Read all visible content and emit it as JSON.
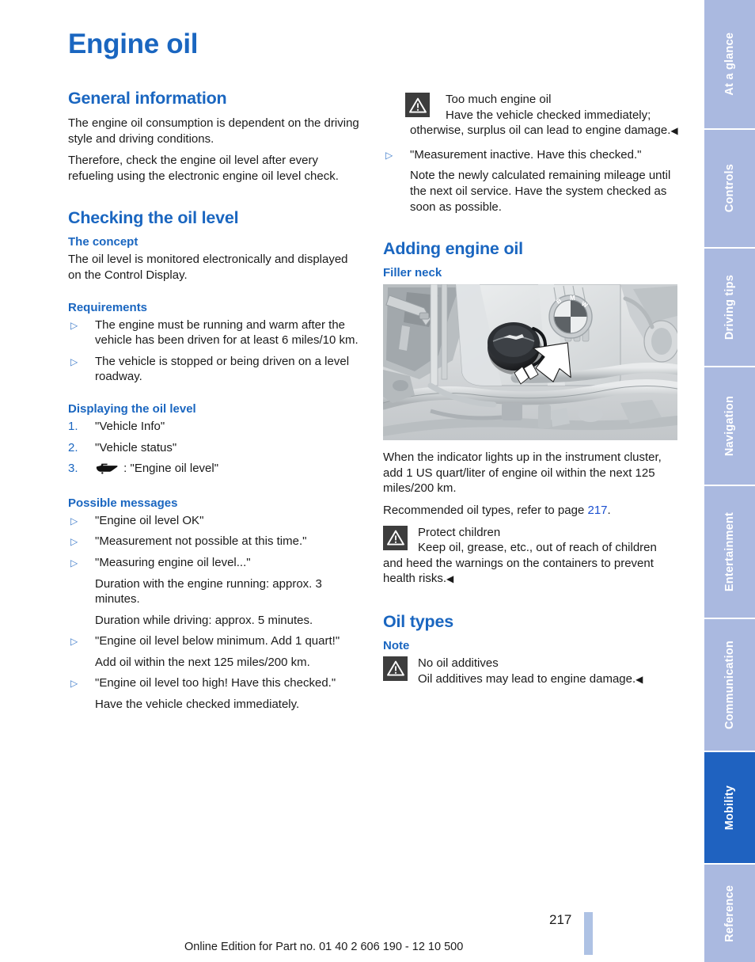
{
  "document": {
    "title": "Engine oil",
    "page_number": "217",
    "footer_note": "Online Edition for Part no. 01 40 2 606 190 - 12 10 500"
  },
  "colors": {
    "heading_blue": "#1a66c0",
    "tab_inactive": "#aab9e0",
    "tab_active": "#1f62c0",
    "link_blue": "#1a4fd0",
    "warning_icon_bg": "#3d3d3d"
  },
  "left_column": {
    "general": {
      "heading": "General information",
      "para1": "The engine oil consumption is dependent on the driving style and driving conditions.",
      "para2": "Therefore, check the engine oil level after every refueling using the electronic engine oil level check."
    },
    "checking": {
      "heading": "Checking the oil level",
      "concept": {
        "subheading": "The concept",
        "para": "The oil level is monitored electronically and displayed on the Control Display."
      },
      "requirements": {
        "subheading": "Requirements",
        "items": [
          "The engine must be running and warm after the vehicle has been driven for at least 6 miles/10 km.",
          "The vehicle is stopped or being driven on a level roadway."
        ]
      },
      "displaying": {
        "subheading": "Displaying the oil level",
        "steps": [
          {
            "num": "1.",
            "text": "\"Vehicle Info\"",
            "icon": null
          },
          {
            "num": "2.",
            "text": "\"Vehicle status\"",
            "icon": null
          },
          {
            "num": "3.",
            "text": ": \"Engine oil level\"",
            "icon": "oil-can-icon"
          }
        ]
      },
      "messages": {
        "subheading": "Possible messages",
        "items": [
          {
            "bullet": "\"Engine oil level OK\"",
            "notes": []
          },
          {
            "bullet": "\"Measurement not possible at this time.\"",
            "notes": []
          },
          {
            "bullet": "\"Measuring engine oil level...\"",
            "notes": [
              "Duration with the engine running: approx. 3 minutes.",
              "Duration while driving: approx. 5 minutes."
            ]
          },
          {
            "bullet": "\"Engine oil level below minimum. Add 1 quart!\"",
            "notes": [
              "Add oil within the next 125 miles/200 km."
            ]
          },
          {
            "bullet": "\"Engine oil level too high! Have this checked.\"",
            "notes": [
              "Have the vehicle checked immediately."
            ]
          }
        ]
      }
    }
  },
  "right_column": {
    "warning_too_much_oil": {
      "title": "Too much engine oil",
      "body": "Have the vehicle checked immediately; otherwise, surplus oil can lead to engine damage.",
      "end_mark": "◀"
    },
    "message_inactive": {
      "bullet": "\"Measurement inactive. Have this checked.\"",
      "note": "Note the newly calculated remaining mileage until the next oil service. Have the system checked as soon as possible."
    },
    "adding": {
      "heading": "Adding engine oil",
      "filler_neck_subheading": "Filler neck",
      "figure_caption_alt": "engine-bay-oil-filler-cap-photo",
      "para1": "When the indicator lights up in the instrument cluster, add 1 US quart/liter of engine oil within the next 125 miles/200 km.",
      "para2_pre": "Recommended oil types, refer to page ",
      "para2_link": "217",
      "para2_post": "."
    },
    "warning_protect_children": {
      "title": "Protect children",
      "body": "Keep oil, grease, etc., out of reach of children and heed the warnings on the containers to prevent health risks.",
      "end_mark": "◀"
    },
    "oil_types": {
      "heading": "Oil types",
      "note_subheading": "Note",
      "warning": {
        "title": "No oil additives",
        "body": "Oil additives may lead to engine damage.",
        "end_mark": "◀"
      }
    }
  },
  "side_tabs": [
    {
      "label": "At a glance",
      "active": false
    },
    {
      "label": "Controls",
      "active": false
    },
    {
      "label": "Driving tips",
      "active": false
    },
    {
      "label": "Navigation",
      "active": false
    },
    {
      "label": "Entertainment",
      "active": false
    },
    {
      "label": "Communication",
      "active": false
    },
    {
      "label": "Mobility",
      "active": true
    },
    {
      "label": "Reference",
      "active": false
    }
  ]
}
